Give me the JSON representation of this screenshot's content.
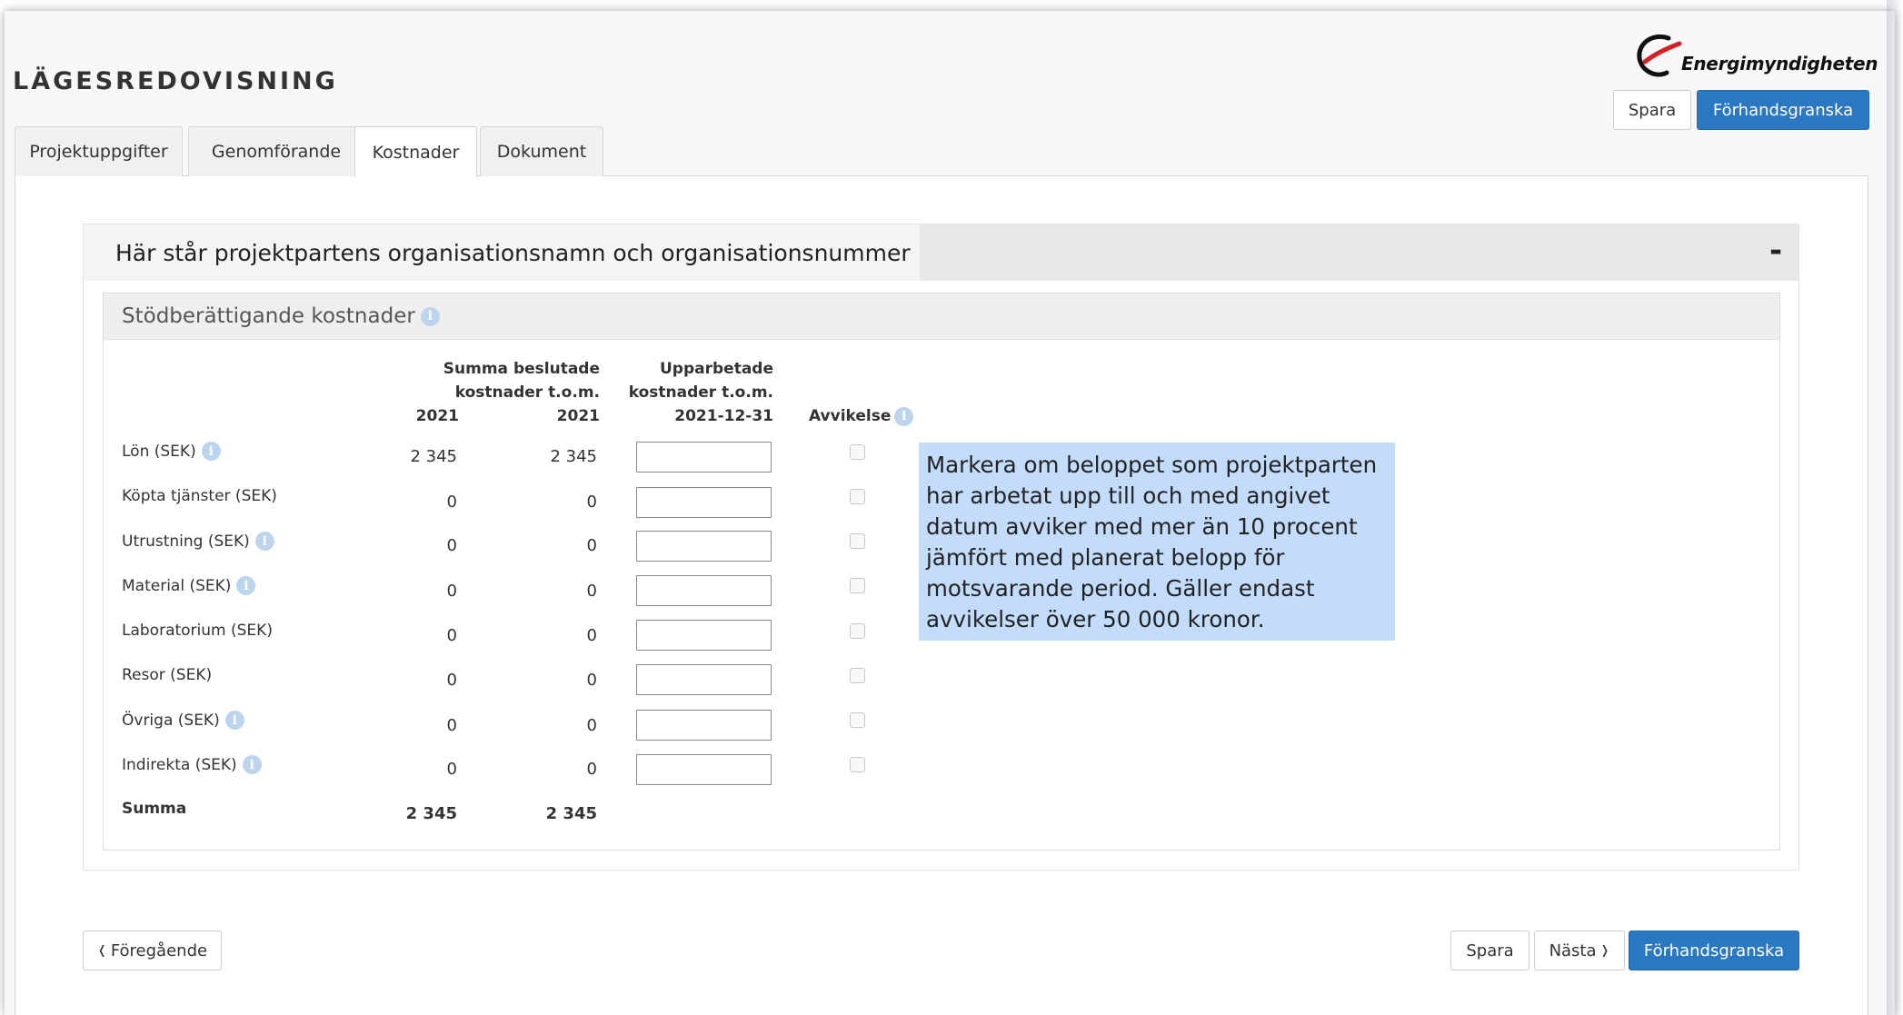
{
  "header": {
    "title": "LÄGESREDOVISNING",
    "logo_text": "Energimyndigheten",
    "save_label": "Spara",
    "preview_label": "Förhandsgranska"
  },
  "tabs": [
    {
      "label": "Projektuppgifter",
      "active": false
    },
    {
      "label": "Genomförande",
      "active": false
    },
    {
      "label": "Kostnader",
      "active": true
    },
    {
      "label": "Dokument",
      "active": false
    }
  ],
  "org_panel": {
    "title": "Här står projektpartens organisationsnamn och organisationsnummer",
    "collapse_label": "-"
  },
  "cost_panel": {
    "title": "Stödberättigande kostnader",
    "columns": {
      "year": "2021",
      "decided_l1": "Summa beslutade",
      "decided_l2": "kostnader t.o.m.",
      "decided_l3": "2021",
      "worked_l1": "Upparbetade",
      "worked_l2": "kostnader t.o.m.",
      "worked_l3": "2021-12-31",
      "deviation": "Avvikelse"
    },
    "rows": [
      {
        "label": "Lön (SEK)",
        "info": true,
        "year": "2 345",
        "decided": "2 345",
        "worked": "",
        "deviation": false
      },
      {
        "label": "Köpta tjänster (SEK)",
        "info": false,
        "year": "0",
        "decided": "0",
        "worked": "",
        "deviation": false
      },
      {
        "label": "Utrustning (SEK)",
        "info": true,
        "year": "0",
        "decided": "0",
        "worked": "",
        "deviation": false
      },
      {
        "label": "Material (SEK)",
        "info": true,
        "year": "0",
        "decided": "0",
        "worked": "",
        "deviation": false
      },
      {
        "label": "Laboratorium (SEK)",
        "info": false,
        "year": "0",
        "decided": "0",
        "worked": "",
        "deviation": false
      },
      {
        "label": "Resor (SEK)",
        "info": false,
        "year": "0",
        "decided": "0",
        "worked": "",
        "deviation": false
      },
      {
        "label": "Övriga (SEK)",
        "info": true,
        "year": "0",
        "decided": "0",
        "worked": "",
        "deviation": false
      },
      {
        "label": "Indirekta (SEK)",
        "info": true,
        "year": "0",
        "decided": "0",
        "worked": "",
        "deviation": false
      }
    ],
    "sum": {
      "label": "Summa",
      "year": "2 345",
      "decided": "2 345"
    },
    "tooltip": "Markera om beloppet som projektparten har arbetat upp till och med angivet datum avviker med mer än 10 procent jämfört med planerat belopp för motsvarande period. Gäller endast avvikelser över 50 000 kronor."
  },
  "footer": {
    "prev_label": "Föregående",
    "save_label": "Spara",
    "next_label": "Nästa",
    "preview_label": "Förhandsgranska"
  },
  "colors": {
    "primary": "#2a78c2",
    "info": "#bcd4ee",
    "tooltip_bg": "#c2dcfa"
  }
}
